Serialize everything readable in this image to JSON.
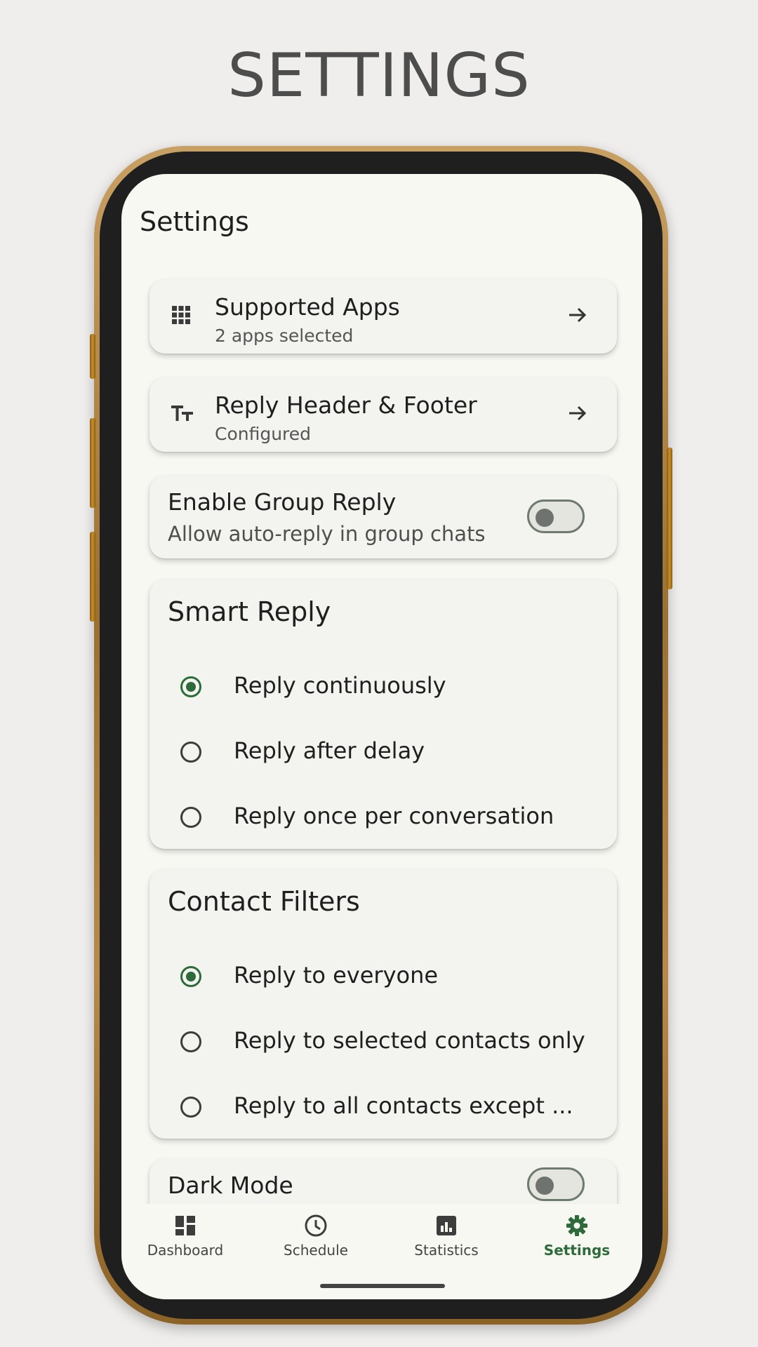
{
  "promo": {
    "title": "SETTINGS"
  },
  "screen": {
    "heading": "Settings",
    "supported_apps": {
      "title": "Supported Apps",
      "subtitle": "2 apps selected",
      "icon": "apps-grid-icon"
    },
    "reply_header_footer": {
      "title": "Reply Header & Footer",
      "subtitle": "Configured",
      "icon": "text-fields-icon"
    },
    "group_reply": {
      "title": "Enable Group Reply",
      "subtitle": "Allow auto-reply in group chats",
      "enabled": false
    },
    "smart_reply": {
      "title": "Smart Reply",
      "options": [
        {
          "label": "Reply continuously",
          "selected": true
        },
        {
          "label": "Reply after delay",
          "selected": false
        },
        {
          "label": "Reply once per conversation",
          "selected": false
        }
      ]
    },
    "contact_filters": {
      "title": "Contact Filters",
      "options": [
        {
          "label": "Reply to everyone",
          "selected": true
        },
        {
          "label": "Reply to selected contacts only",
          "selected": false
        },
        {
          "label": "Reply to all contacts except ...",
          "selected": false
        }
      ]
    },
    "dark_mode": {
      "title": "Dark Mode",
      "enabled": false
    }
  },
  "bottom_nav": {
    "items": [
      {
        "label": "Dashboard",
        "icon": "dashboard-icon",
        "active": false
      },
      {
        "label": "Schedule",
        "icon": "clock-icon",
        "active": false
      },
      {
        "label": "Statistics",
        "icon": "bar-chart-icon",
        "active": false
      },
      {
        "label": "Settings",
        "icon": "gear-icon",
        "active": true
      }
    ]
  },
  "colors": {
    "accent": "#2e6b3a",
    "frame": "#9b7034",
    "background": "#efeeed",
    "screen": "#f8f8f3"
  }
}
